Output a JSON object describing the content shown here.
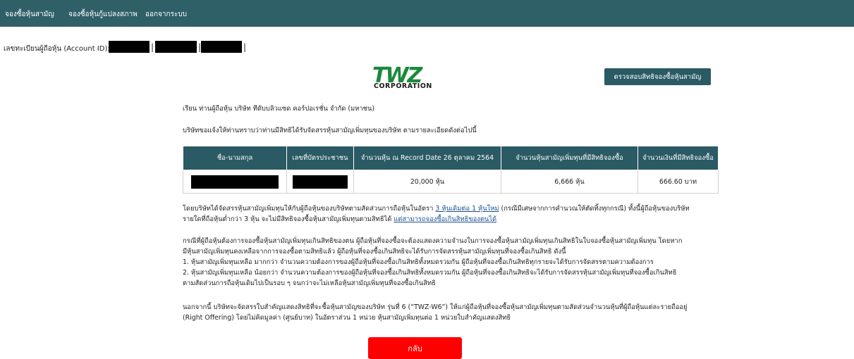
{
  "nav": {
    "items": [
      "จองซื้อหุ้นสามัญ",
      "จองซื้อหุ้นกู้แปลงสภาพ",
      "ออกจากระบบ"
    ]
  },
  "account": {
    "label": "เลขทะเบียนผู้ถือหุ้น (Account ID):",
    "separator": "|"
  },
  "logo": {
    "name": "TWZ",
    "sub": "CORPORATION",
    "color": "#1b8a3a"
  },
  "check_button": {
    "label": "ตรวจสอบสิทธิจองซื้อหุ้นสามัญ"
  },
  "letter": {
    "greeting": "เรียน ท่านผู้ถือหุ้น บริษัท ทีดับบลิวแซด คอร์ปอเรชั่น จำกัด (มหาชน)",
    "intro": "บริษัทขอแจ้งให้ท่านทราบว่าท่านมีสิทธิได้รับจัดสรรหุ้นสามัญเพิ่มทุนของบริษัท ตามรายละเอียดดังต่อไปนี้"
  },
  "table": {
    "headers": [
      "ชื่อ-นามสกุล",
      "เลขที่บัตรประชาชน",
      "จำนวนหุ้น ณ Record Date 26 ตุลาคม 2564",
      "จำนวนหุ้นสามัญเพิ่มทุนที่มีสิทธิจองซื้อ",
      "จำนวนเงินที่มีสิทธิจองซื้อ"
    ],
    "row": {
      "shares": "20,000 หุ้น",
      "rights_shares": "6,666 หุ้น",
      "amount": "666.60 บาท"
    }
  },
  "allocation": {
    "line1_a": "โดยบริษัทได้จัดสรรหุ้นสามัญเพิ่มทุนให้กับผู้ถือหุ้นของบริษัทตามสัดส่วนการถือหุ้นในอัตรา ",
    "ratio_link": "3 หุ้นเดิมต่อ 1 หุ้นใหม่",
    "line1_b": " (กรณีมีเศษจากการคำนวณให้ตัดทิ้งทุกกรณี) ทั้งนี้ผู้ถือหุ้นของบริษัท",
    "line2_a": "รายใดที่ถือหุ้นต่ำกว่า 3 หุ้น จะไม่มีสิทธิจองซื้อหุ้นสามัญเพิ่มทุนตามสิทธิได้ ",
    "excess_link": "แต่สามารถจองซื้อเกินสิทธิของตนได้"
  },
  "excess": {
    "l1": "กรณีที่ผู้ถือหุ้นต้องการจองซื้อหุ้นสามัญเพิ่มทุนเกินสิทธิของตน ผู้ถือหุ้นที่จองซื้อจะต้องแสดงความจำนงในการจองซื้อหุ้นสามัญเพิ่มทุนเกินสิทธิในใบจองซื้อหุ้นสามัญเพิ่มทุน โดยหาก",
    "l2": "มีหุ้นสามัญเพิ่มทุนคงเหลือจากการจองซื้อตามสิทธิแล้ว ผู้ถือหุ้นที่จองซื้อเกินสิทธิจะได้รับการจัดสรรหุ้นสามัญเพิ่มทุนที่จองซื้อเกินสิทธิ ดังนี้",
    "l3": "1. หุ้นสามัญเพิ่มทุนเหลือ มากกว่า จำนวนความต้องการของผู้ถือหุ้นที่จองซื้อเกินสิทธิทั้งหมดรวมกัน ผู้ถือหุ้นที่จองซื้อเกินสิทธิทุกรายจะได้รับการจัดสรรตามความต้องการ",
    "l4": "2. หุ้นสามัญเพิ่มทุนเหลือ น้อยกว่า จำนวนความต้องการของผู้ถือหุ้นที่จองซื้อเกินสิทธิทั้งหมดรวมกัน ผู้ถือหุ้นที่จองซื้อเกินสิทธิจะได้รับการจัดสรรหุ้นสามัญเพิ่มทุนที่จองซื้อเกินสิทธิ",
    "l5": "ตามสัดส่วนการถือหุ้นเดิมไปเป็นรอบ ๆ จนกว่าจะไม่เหลือหุ้นสามัญเพิ่มทุนที่จองซื้อเกินสิทธิ"
  },
  "warrant": {
    "l1": "นอกจากนี้ บริษัทจะจัดสรรใบสำคัญแสดงสิทธิที่จะซื้อหุ้นสามัญของบริษัท รุ่นที่ 6 (“TWZ-W6”) ให้แก่ผู้ถือหุ้นที่จองซื้อหุ้นสามัญเพิ่มทุนตามสัดส่วนจำนวนหุ้นที่ผู้ถือหุ้นแต่ละรายถืออยู่",
    "l2": "(Right Offering) โดยไม่คิดมูลค่า (ศูนย์บาท) ในอัตราส่วน 1 หน่วย หุ้นสามัญเพิ่มทุนต่อ 1 หน่วยใบสำคัญแสดงสิทธิ"
  },
  "back_button": {
    "label": "กลับ"
  }
}
